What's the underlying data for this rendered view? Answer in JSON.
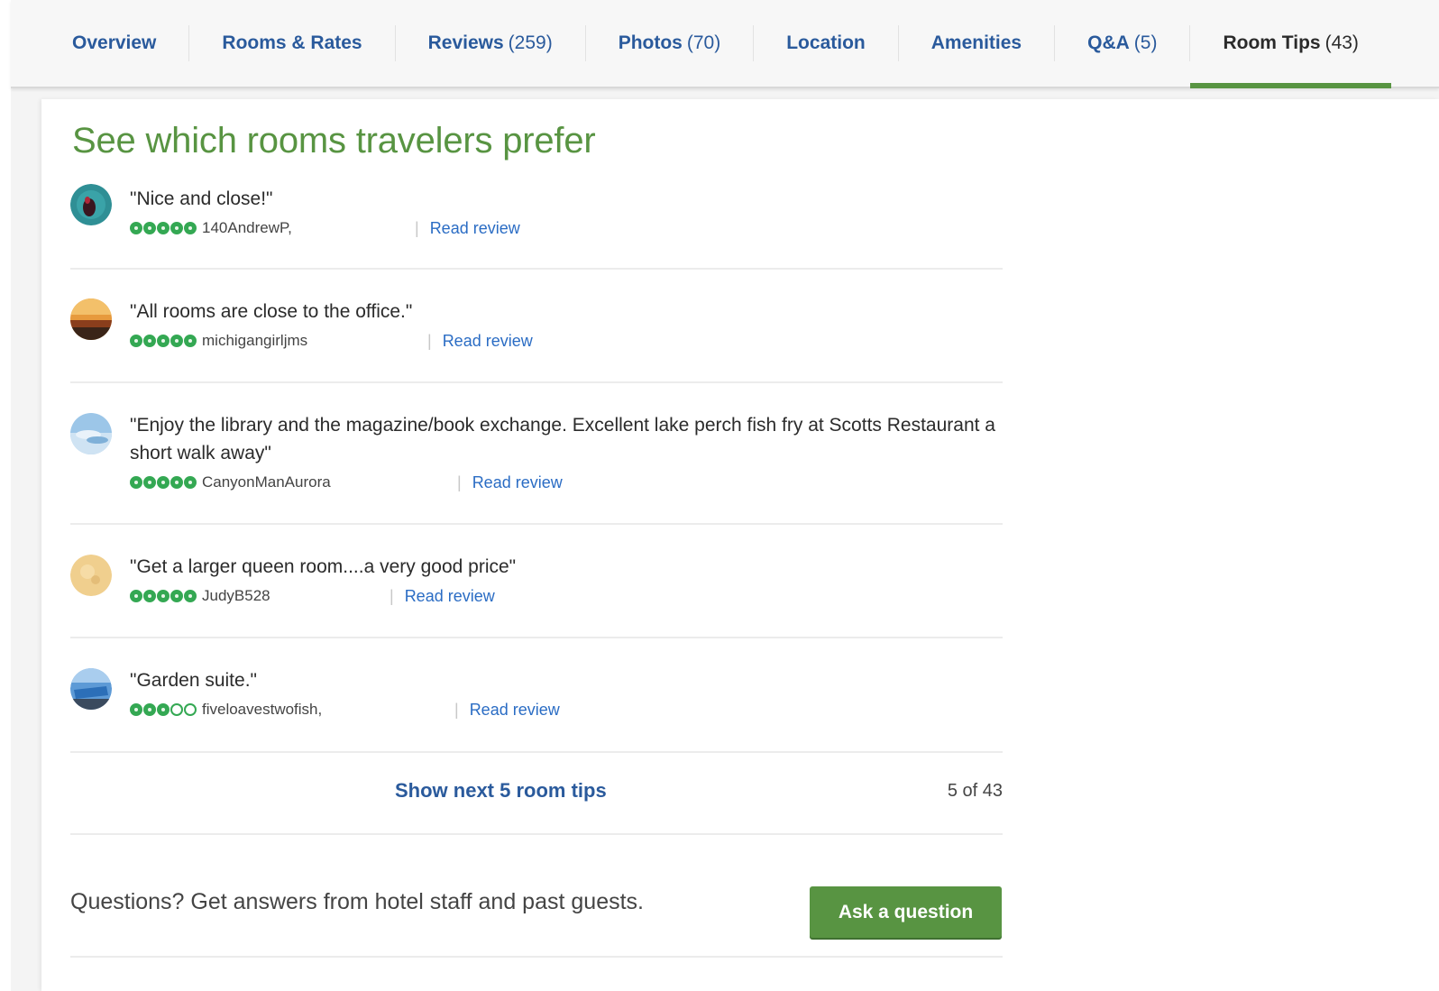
{
  "tabs": [
    {
      "label": "Overview",
      "count": ""
    },
    {
      "label": "Rooms & Rates",
      "count": ""
    },
    {
      "label": "Reviews",
      "count": "(259)"
    },
    {
      "label": "Photos",
      "count": "(70)"
    },
    {
      "label": "Location",
      "count": ""
    },
    {
      "label": "Amenities",
      "count": ""
    },
    {
      "label": "Q&A",
      "count": "(5)"
    },
    {
      "label": "Room Tips",
      "count": "(43)",
      "active": true
    }
  ],
  "main": {
    "heading": "See which rooms travelers prefer"
  },
  "tips": [
    {
      "quote": "\"Nice and close!\"",
      "user": "140AndrewP,",
      "rating": 5,
      "link": "Read review",
      "avatar": "dark-teal-avatar"
    },
    {
      "quote": "\"All rooms are close to the office.\"",
      "user": "michigangirljms",
      "rating": 5,
      "link": "Read review",
      "avatar": "sunset-avatar"
    },
    {
      "quote": "\"Enjoy the library and the magazine/book exchange. Excellent lake perch fish fry at Scotts Restaurant a short walk away\"",
      "user": "CanyonManAurora",
      "rating": 5,
      "link": "Read review",
      "avatar": "sky-avatar"
    },
    {
      "quote": "\"Get a larger queen room....a very good price\"",
      "user": "JudyB528",
      "rating": 5,
      "link": "Read review",
      "avatar": "sand-avatar"
    },
    {
      "quote": "\"Garden suite.\"",
      "user": "fiveloavestwofish,",
      "rating": 3,
      "link": "Read review",
      "avatar": "water-avatar"
    }
  ],
  "pagination": {
    "show_next": "Show next 5 room tips",
    "count": "5 of 43"
  },
  "questions": {
    "text": "Questions? Get answers from hotel staff and past guests.",
    "button": "Ask a question"
  },
  "colors": {
    "accent_green": "#589442",
    "link_blue": "#2a5a9c",
    "bubble_green": "#34a853"
  }
}
